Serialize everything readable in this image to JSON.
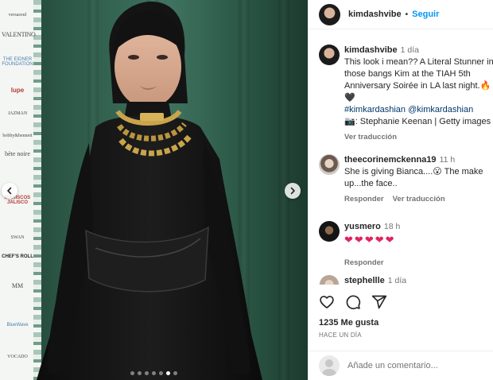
{
  "post": {
    "username": "kimdashvibe",
    "separator": "•",
    "follow_label": "Seguir"
  },
  "caption": {
    "username": "kimdashvibe",
    "time": "1 día",
    "line1": "This look i mean?? A Literal Stunner in",
    "line2": "those bangs Kim at the TIAH 5th",
    "line3": "Anniversary Soirée in LA last night.🔥",
    "line4": "🖤",
    "hashtag": "#kimkardashian",
    "mention": "@kimkardashian",
    "credit": "📷: Stephanie Keenan | Getty images",
    "translate": "Ver traducción"
  },
  "comments": [
    {
      "username": "theecorinemckenna19",
      "time": "11 h",
      "line1": "She is giving Bianca....😮 The make",
      "line2": "up...the face..",
      "reply": "Responder",
      "translate": "Ver traducción"
    },
    {
      "username": "yusmero",
      "time": "18 h",
      "hearts": [
        "❤",
        "❤",
        "❤",
        "❤",
        "❤"
      ],
      "reply": "Responder"
    },
    {
      "username": "stephellle",
      "time": "1 día"
    }
  ],
  "stats": {
    "likes": "1235 Me gusta",
    "ago": "HACE UN DÍA"
  },
  "comment_box": {
    "placeholder": "Añade un comentario..."
  },
  "carousel": {
    "total": 7,
    "active_index": 5
  },
  "sponsor_wall": {
    "logos": [
      "versasoul",
      "VALENTINO",
      "THE EIDNER FOUNDATION",
      "lupe",
      "JAZMAN",
      "bobby&bennett",
      "bète noire",
      "MARISCOS JALISCO",
      "SWAN",
      "CHEF'S ROLL",
      "MM",
      "BlueWave",
      "VOCADO"
    ]
  },
  "colors": {
    "accent": "#0095f6",
    "text_secondary": "#737373",
    "heart": "#e0245e"
  }
}
